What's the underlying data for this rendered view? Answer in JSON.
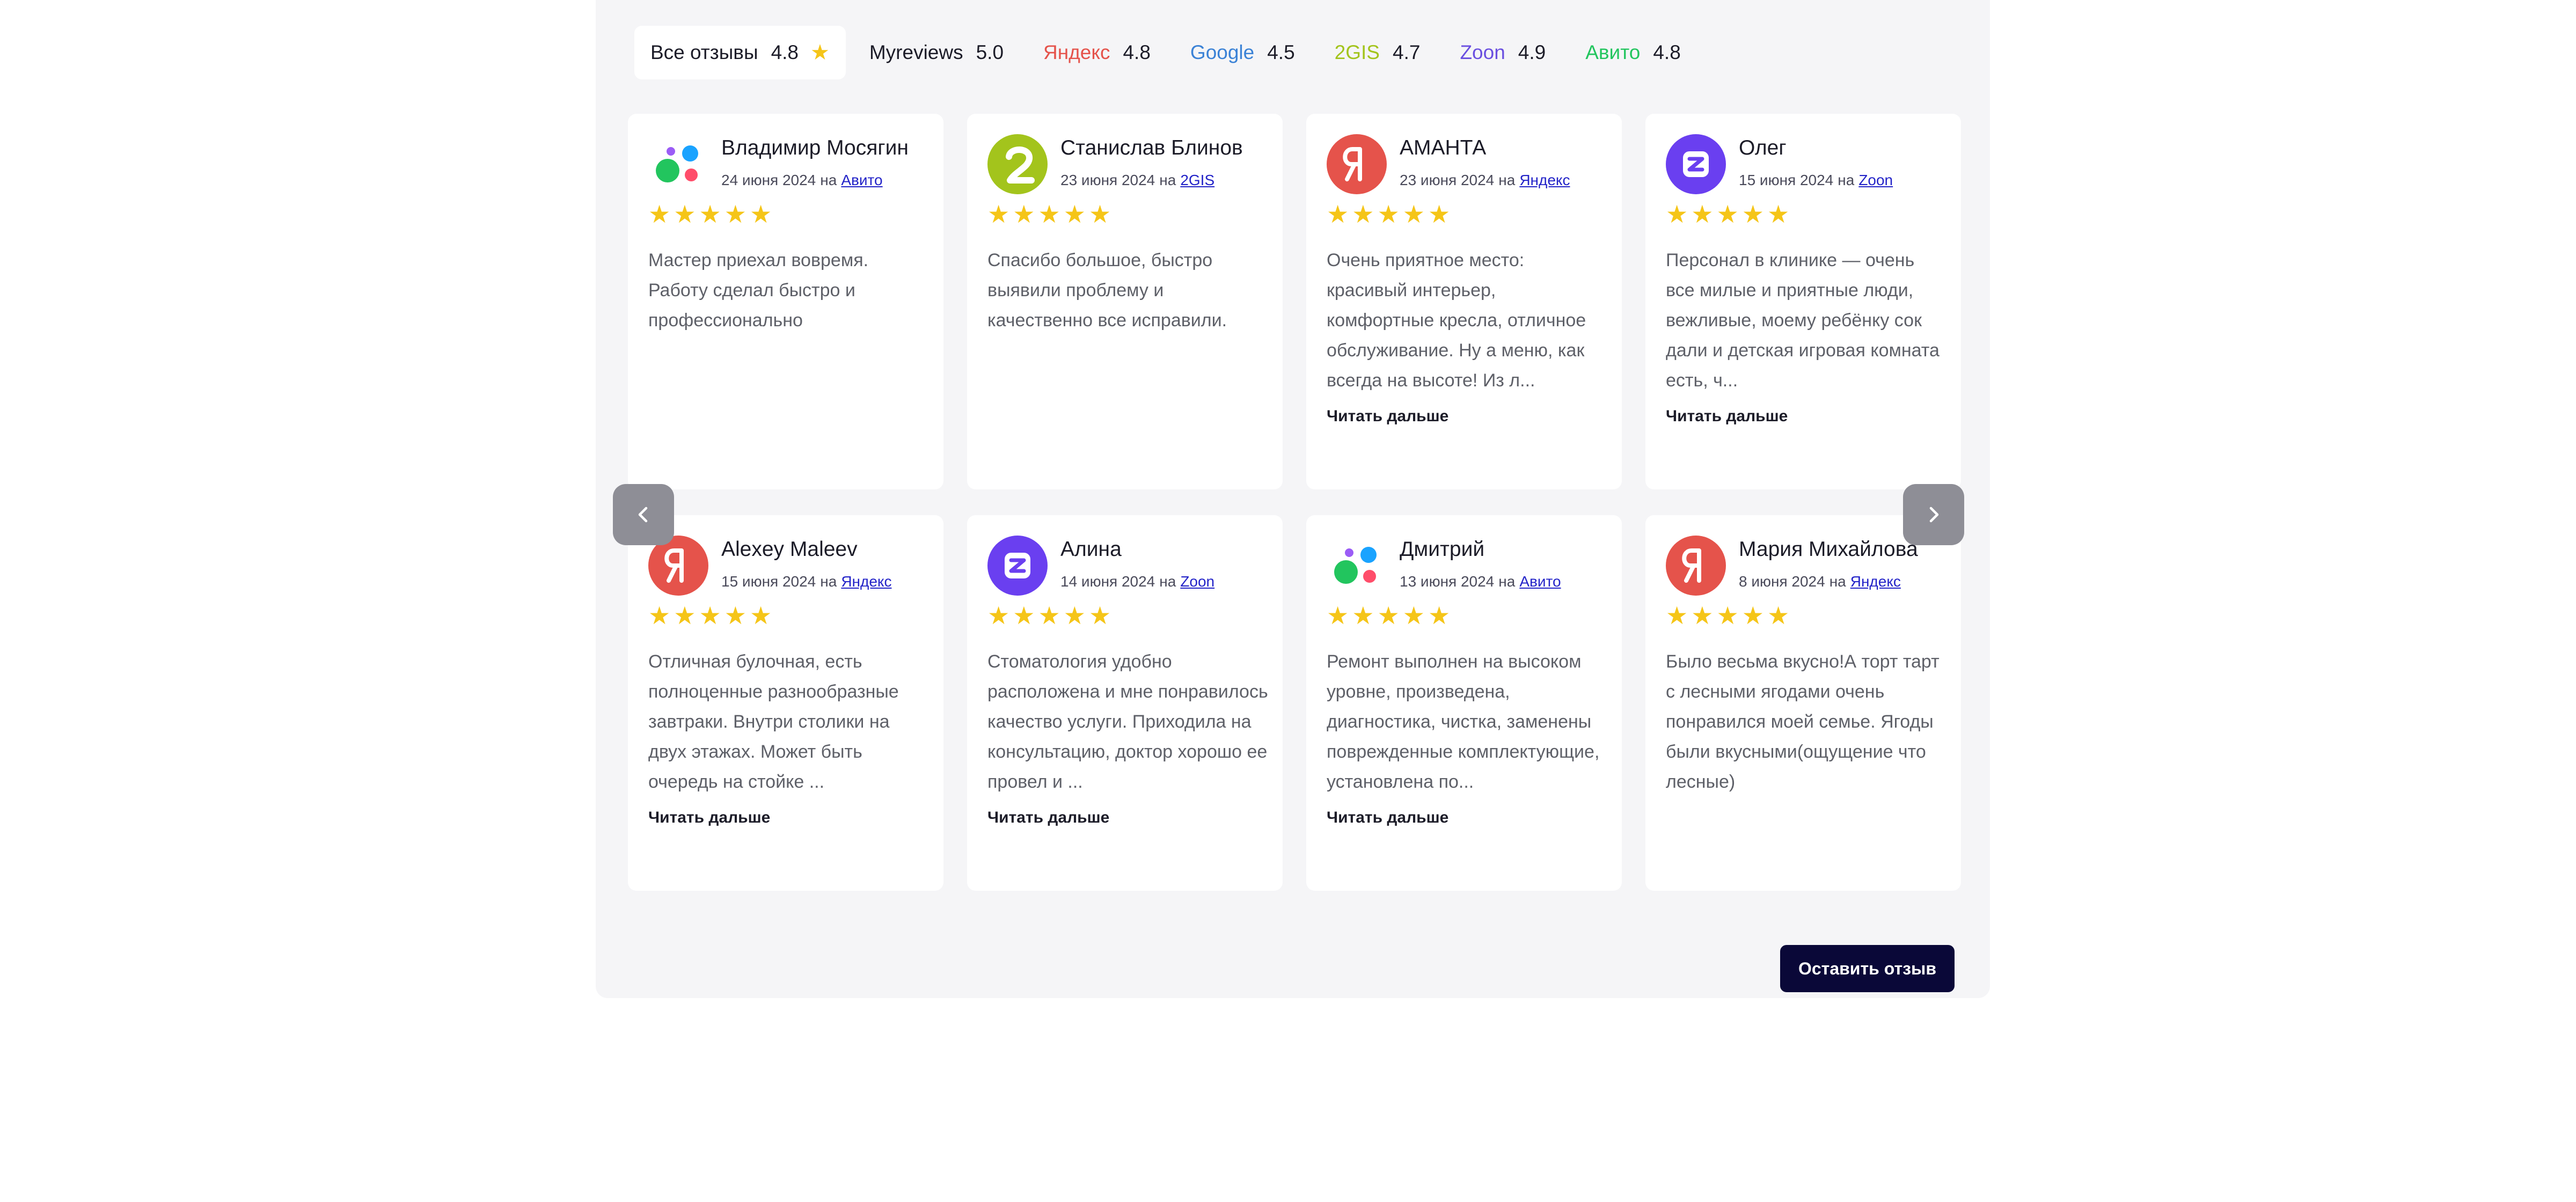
{
  "tabs": [
    {
      "name": "Все отзывы",
      "rating": "4.8",
      "color": "#1c1c28",
      "active": true,
      "star": "★"
    },
    {
      "name": "Myreviews",
      "rating": "5.0",
      "color": "#1c1c28"
    },
    {
      "name": "Яндекс",
      "rating": "4.8",
      "color": "#e5534b"
    },
    {
      "name": "Google",
      "rating": "4.5",
      "color": "#3b82d6"
    },
    {
      "name": "2GIS",
      "rating": "4.7",
      "color": "#a3c41c"
    },
    {
      "name": "Zoon",
      "rating": "4.9",
      "color": "#6a4fe0"
    },
    {
      "name": "Авито",
      "rating": "4.8",
      "color": "#22c55e"
    }
  ],
  "cards": [
    {
      "author": "Владимир Мосягин",
      "date": "24 июня 2024",
      "on": "на",
      "source": "Авито",
      "avatar": "avito-logo-icon",
      "stars": "★★★★★",
      "text": "Мастер приехал вовремя. Работу сделал быстро и профессионально",
      "more": ""
    },
    {
      "author": "Станислав Блинов",
      "date": "23 июня 2024",
      "on": "на",
      "source": "2GIS",
      "avatar": "2gis-logo-icon",
      "stars": "★★★★★",
      "text": "Спасибо большое, быстро выявили проблему и качественно все исправили.",
      "more": ""
    },
    {
      "author": "АМАНТА",
      "date": "23 июня 2024",
      "on": "на",
      "source": "Яндекс",
      "avatar": "yandex-logo-icon",
      "stars": "★★★★★",
      "text": "Очень приятное место: красивый интерьер, комфортные кресла, отличное обслуживание. Ну а меню, как всегда на высоте! Из л...",
      "more": "Читать дальше"
    },
    {
      "author": "Олег",
      "date": "15 июня 2024",
      "on": "на",
      "source": "Zoon",
      "avatar": "zoon-logo-icon",
      "stars": "★★★★★",
      "text": "Персонал в клинике — очень все милые и приятные люди, вежливые, моему ребёнку сок дали и детская игровая комната есть, ч...",
      "more": "Читать дальше"
    },
    {
      "author": "Alexey Maleev",
      "date": "15 июня 2024",
      "on": "на",
      "source": "Яндекс",
      "avatar": "yandex-logo-icon",
      "stars": "★★★★★",
      "text": "Отличная булочная, есть полноценные разнообразные завтраки. Внутри столики на двух этажах. Может быть очередь на стойке ...",
      "more": "Читать дальше"
    },
    {
      "author": "Алина",
      "date": "14 июня 2024",
      "on": "на",
      "source": "Zoon",
      "avatar": "zoon-logo-icon",
      "stars": "★★★★★",
      "text": "Стоматология удобно расположена и мне понравилось качество услуги. Приходила на консультацию, доктор хорошо ее провел и ...",
      "more": "Читать дальше"
    },
    {
      "author": "Дмитрий",
      "date": "13 июня 2024",
      "on": "на",
      "source": "Авито",
      "avatar": "avito-logo-icon",
      "stars": "★★★★★",
      "text": "Ремонт выполнен на высоком уровне, произведена, диагностика, чистка, заменены поврежденные комплектующие, установлена по...",
      "more": "Читать дальше"
    },
    {
      "author": "Мария Михайлова",
      "date": "8 июня 2024",
      "on": "на",
      "source": "Яндекс",
      "avatar": "yandex-logo-icon",
      "stars": "★★★★★",
      "text": "Было весьма вкусно!А торт тарт с лесными ягодами очень понравился моей семье. Ягоды были вкусными(ощущение что лесные)",
      "more": ""
    }
  ],
  "nav": {
    "prev_icon": "chevron-left-icon",
    "next_icon": "chevron-right-icon"
  },
  "leave_review_label": "Оставить отзыв"
}
